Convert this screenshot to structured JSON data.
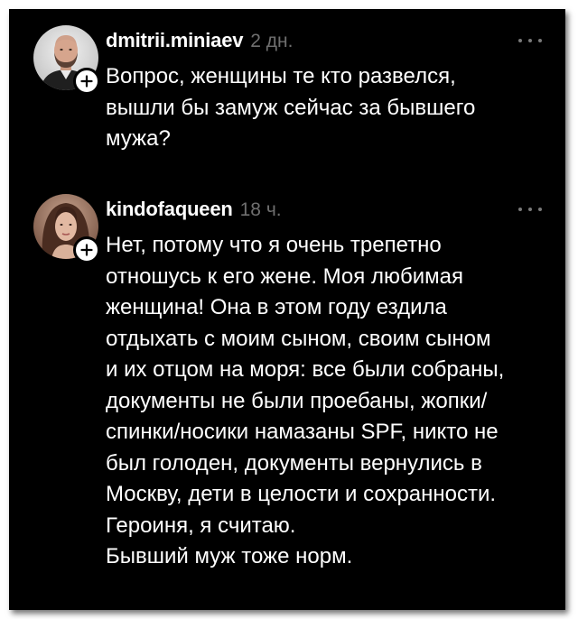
{
  "posts": [
    {
      "username": "dmitrii.miniaev",
      "timestamp": "2 дн.",
      "avatar_icon": "profile-photo-man",
      "follow_icon": "plus-icon",
      "more_icon": "more-dots-icon",
      "lines": [
        "Вопрос, женщины те кто развелся,",
        "вышли бы замуж сейчас за бывшего",
        "мужа?"
      ]
    },
    {
      "username": "kindofaqueen",
      "timestamp": "18 ч.",
      "avatar_icon": "profile-photo-woman",
      "follow_icon": "plus-icon",
      "more_icon": "more-dots-icon",
      "lines": [
        "Нет, потому что я очень трепетно",
        "отношусь к его жене. Моя любимая",
        "женщина! Она в этом году ездила",
        "отдыхать с моим сыном, своим сыном",
        "и их отцом на моря:  все были собраны,",
        "документы не были проебаны, жопки/",
        "спинки/носики намазаны SPF, никто не",
        "был голоден, документы вернулись в",
        "Москву, дети в целости и сохранности.",
        "Героиня, я считаю.",
        "Бывший муж тоже норм."
      ]
    }
  ],
  "colors": {
    "background": "#000000",
    "text": "#ffffff",
    "muted": "#6f6f6f"
  }
}
